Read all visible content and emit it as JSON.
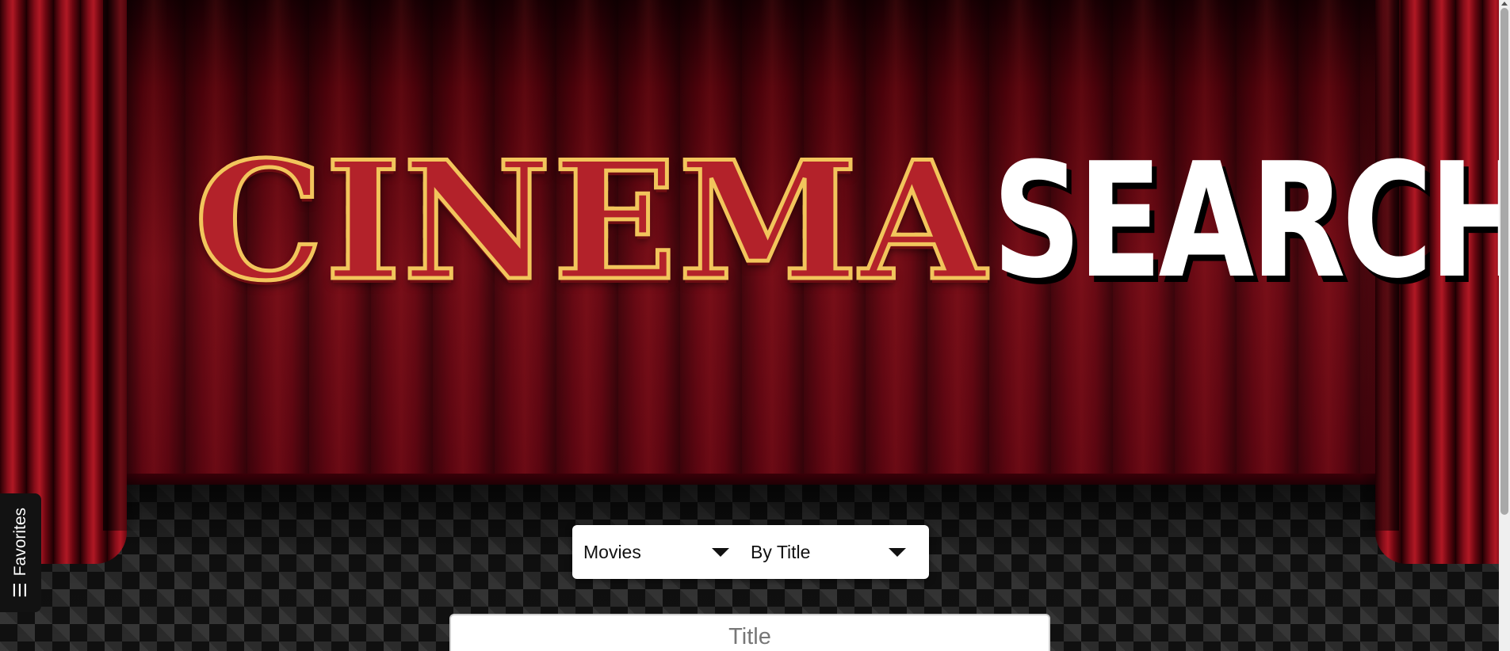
{
  "logo": {
    "marquee": "CINEMA",
    "search": "SEARCH"
  },
  "favorites": {
    "icon": "hamburger-icon",
    "label": "Favorites"
  },
  "filters": {
    "media_type": "Movies",
    "search_mode": "By Title"
  },
  "search": {
    "placeholder": "Title"
  },
  "colors": {
    "curtain": "#6a0a14",
    "marquee_red": "#b3222a",
    "marquee_gold": "#f2c55c",
    "search_text": "#ffffff"
  }
}
